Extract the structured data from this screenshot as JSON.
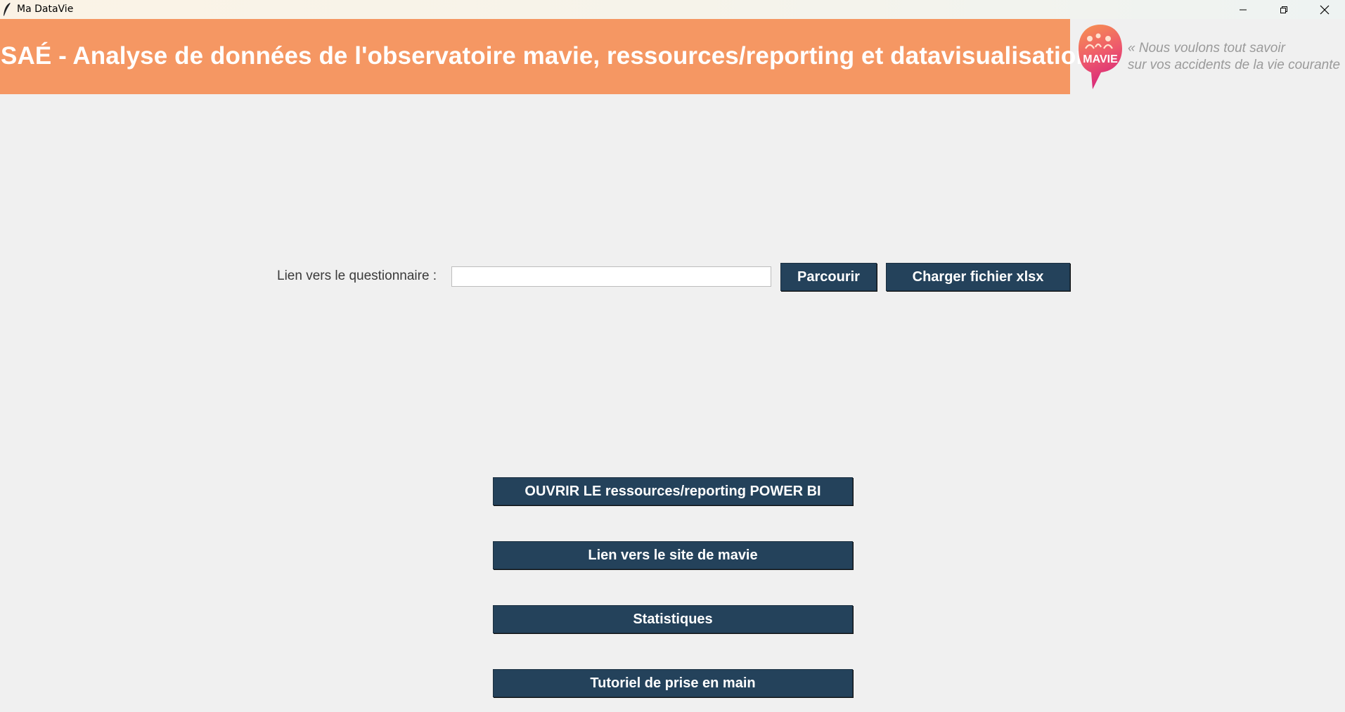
{
  "window": {
    "title": "Ma DataVie",
    "controls": {
      "minimize_icon": "minimize-icon",
      "maximize_icon": "restore-icon",
      "close_icon": "close-icon"
    }
  },
  "header": {
    "title": "SAÉ - Analyse de données de l'observatoire mavie, ressources/reporting et datavisualisation",
    "logo_text": "MAVIE",
    "slogan_line1": "« Nous voulons tout savoir",
    "slogan_line2": "sur vos accidents de la vie courante",
    "banner_color": "#f59763"
  },
  "form": {
    "label": "Lien vers le questionnaire :",
    "input_value": "",
    "browse_label": "Parcourir",
    "load_label": "Charger fichier xlsx"
  },
  "actions": {
    "powerbi_label": "OUVRIR LE ressources/reporting POWER BI",
    "site_label": "Lien vers le site de mavie",
    "stats_label": "Statistiques",
    "tutorial_label": "Tutoriel de prise en main"
  },
  "colors": {
    "button_bg": "#24425b",
    "button_text": "#ffffff",
    "window_bg": "#f0f0f0"
  }
}
